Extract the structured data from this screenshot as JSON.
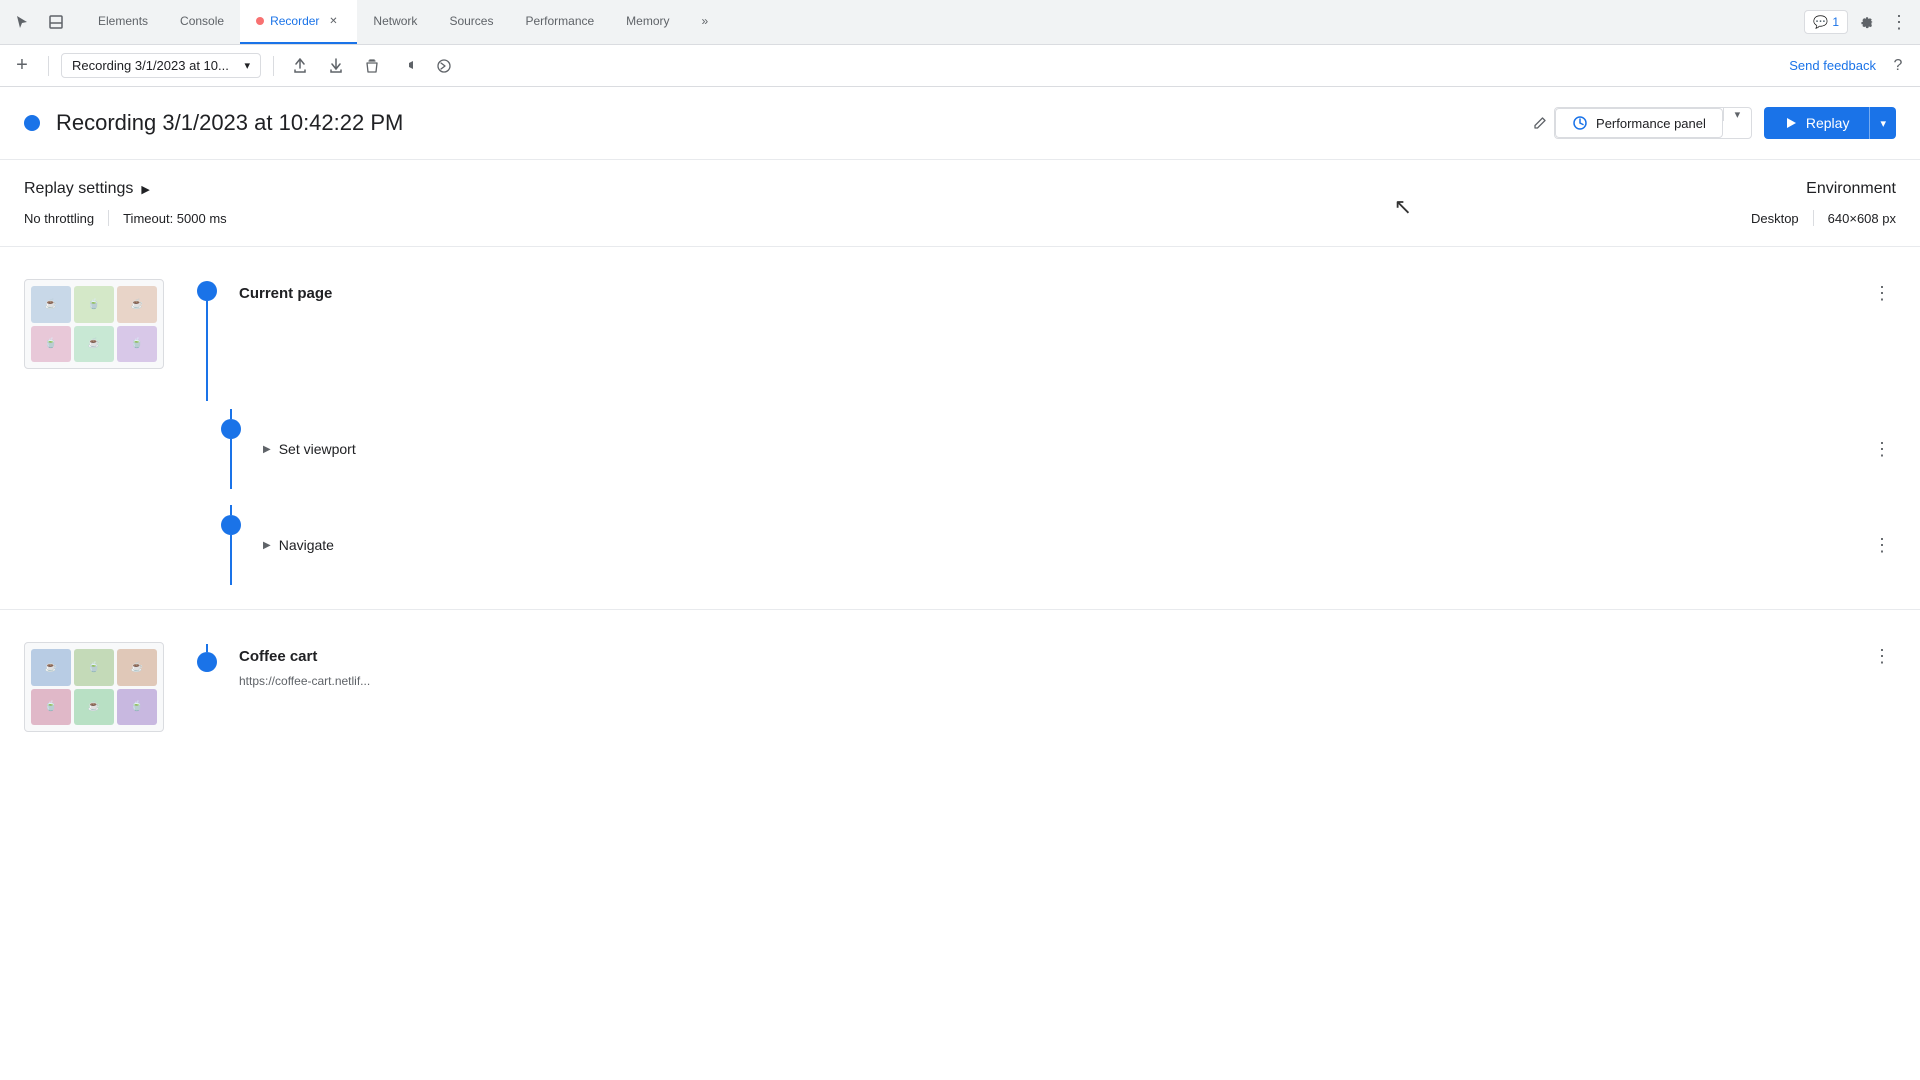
{
  "tabs": [
    {
      "id": "elements",
      "label": "Elements",
      "active": false
    },
    {
      "id": "console",
      "label": "Console",
      "active": false
    },
    {
      "id": "recorder",
      "label": "Recorder",
      "active": true,
      "hasClose": true,
      "hasDot": true
    },
    {
      "id": "network",
      "label": "Network",
      "active": false
    },
    {
      "id": "sources",
      "label": "Sources",
      "active": false
    },
    {
      "id": "performance",
      "label": "Performance",
      "active": false
    },
    {
      "id": "memory",
      "label": "Memory",
      "active": false
    }
  ],
  "toolbar": {
    "add_label": "+",
    "recording_name": "Recording 3/1/2023 at 10...",
    "send_feedback": "Send feedback"
  },
  "recording": {
    "title": "Recording 3/1/2023 at 10:42:22 PM",
    "perf_panel_label": "Performance panel",
    "replay_label": "Replay"
  },
  "settings": {
    "title": "Replay settings",
    "throttling": "No throttling",
    "timeout": "Timeout: 5000 ms",
    "env_title": "Environment",
    "env_type": "Desktop",
    "env_size": "640×608 px"
  },
  "steps": [
    {
      "id": "current-page",
      "group_title": "Current page",
      "has_thumbnail": true,
      "sub_steps": [
        {
          "label": "Set viewport",
          "expandable": true
        },
        {
          "label": "Navigate",
          "expandable": true
        }
      ]
    },
    {
      "id": "coffee-cart",
      "group_title": "Coffee cart",
      "group_url": "https://coffee-cart.netlify.app/",
      "has_thumbnail": true,
      "sub_steps": []
    }
  ],
  "icons": {
    "cursor": "↖",
    "expand_more": "»",
    "chevron_down": "▾",
    "play": "▶",
    "three_dots": "⋮",
    "expand_arrow": "▶",
    "edit": "✎",
    "plus": "+",
    "upload": "↑",
    "download": "↓",
    "trash": "🗑",
    "replay_step": "↻",
    "settings": "⚙",
    "more_tabs": "»",
    "chat": "💬",
    "help": "?"
  }
}
